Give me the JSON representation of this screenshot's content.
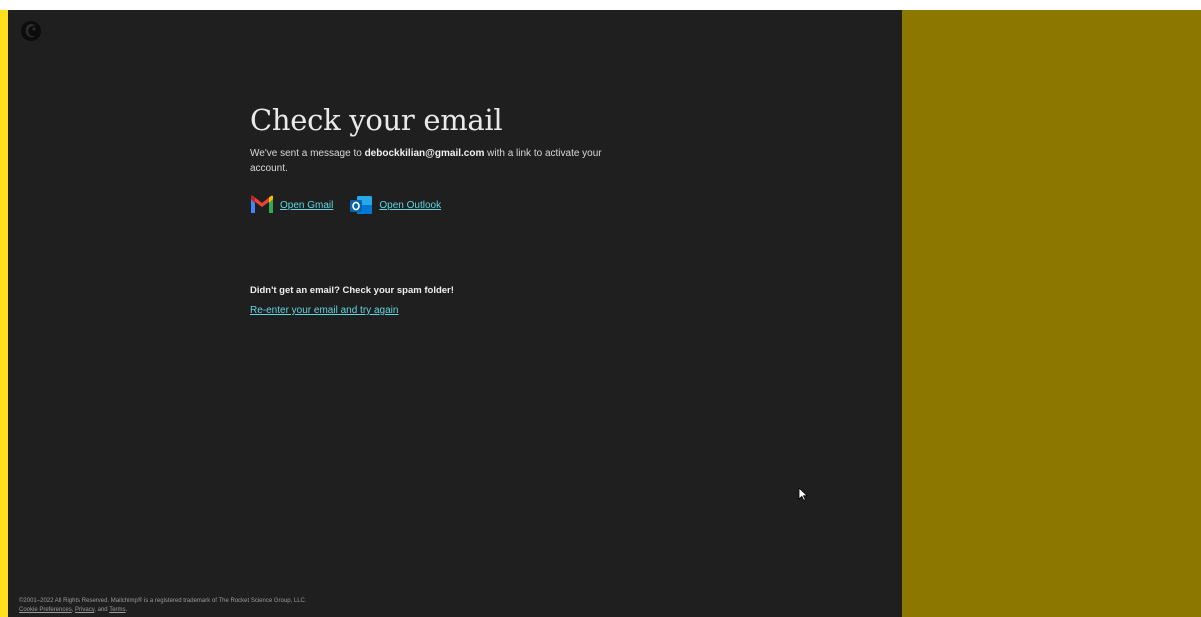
{
  "page": {
    "title": "Check your email",
    "message_prefix": "We've sent a message to ",
    "email": "debockkilian@gmail.com",
    "message_suffix": " with a link to activate your account."
  },
  "links": {
    "gmail": {
      "label": "Open Gmail",
      "icon": "gmail-icon"
    },
    "outlook": {
      "label": "Open Outlook",
      "icon": "outlook-icon"
    }
  },
  "help": {
    "spam_note": "Didn't get an email? Check your spam folder!",
    "reenter_label": "Re-enter your email and try again"
  },
  "footer": {
    "copyright": "©2001–2022 All Rights Reserved. Mailchimp® is a registered trademark of The Rocket Science Group, LLC.",
    "cookie_label": "Cookie Preferences",
    "sep1": ", ",
    "privacy_label": "Privacy",
    "sep2": ", and ",
    "terms_label": "Terms",
    "end": "."
  },
  "colors": {
    "accent_yellow": "#ffe01b",
    "side_panel": "#8c7800",
    "background": "#1f1f20",
    "link": "#5fd6e0"
  }
}
